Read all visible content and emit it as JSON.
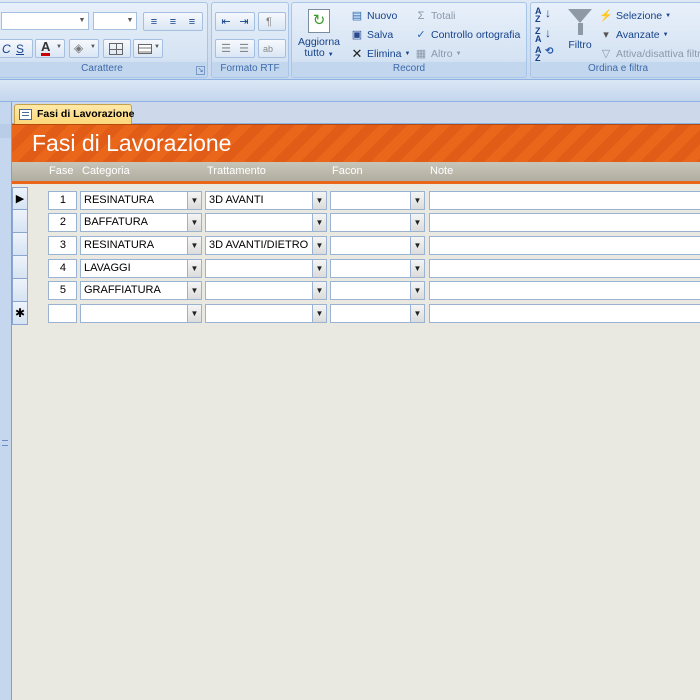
{
  "ribbon": {
    "carattere": {
      "label": "Carattere",
      "italic_label": "C",
      "strike_label": "S",
      "font_color_label": "A"
    },
    "formato_rtf": {
      "label": "Formato RTF"
    },
    "aggiorna": {
      "label_line1": "Aggiorna",
      "label_line2": "tutto"
    },
    "record": {
      "label": "Record",
      "nuovo": "Nuovo",
      "salva": "Salva",
      "elimina": "Elimina",
      "totali": "Totali",
      "controllo": "Controllo ortografia",
      "altro": "Altro"
    },
    "ordina": {
      "label": "Ordina e filtra",
      "filtro": "Filtro",
      "selezione": "Selezione",
      "avanzate": "Avanzate",
      "attiva": "Attiva/disattiva filtro"
    }
  },
  "tab": {
    "label": "Fasi di Lavorazione"
  },
  "form": {
    "title": "Fasi di Lavorazione",
    "columns": {
      "fase": "Fase",
      "categoria": "Categoria",
      "trattamento": "Trattamento",
      "facon": "Facon",
      "note": "Note"
    },
    "rows": [
      {
        "fase": "1",
        "categoria": "RESINATURA",
        "trattamento": "3D AVANTI",
        "facon": "",
        "note": ""
      },
      {
        "fase": "2",
        "categoria": "BAFFATURA",
        "trattamento": "",
        "facon": "",
        "note": ""
      },
      {
        "fase": "3",
        "categoria": "RESINATURA",
        "trattamento": "3D AVANTI/DIETRO",
        "facon": "",
        "note": ""
      },
      {
        "fase": "4",
        "categoria": "LAVAGGI",
        "trattamento": "",
        "facon": "",
        "note": ""
      },
      {
        "fase": "5",
        "categoria": "GRAFFIATURA",
        "trattamento": "",
        "facon": "",
        "note": ""
      }
    ],
    "new_row_marker": "✱",
    "current_row_marker": "▶"
  }
}
